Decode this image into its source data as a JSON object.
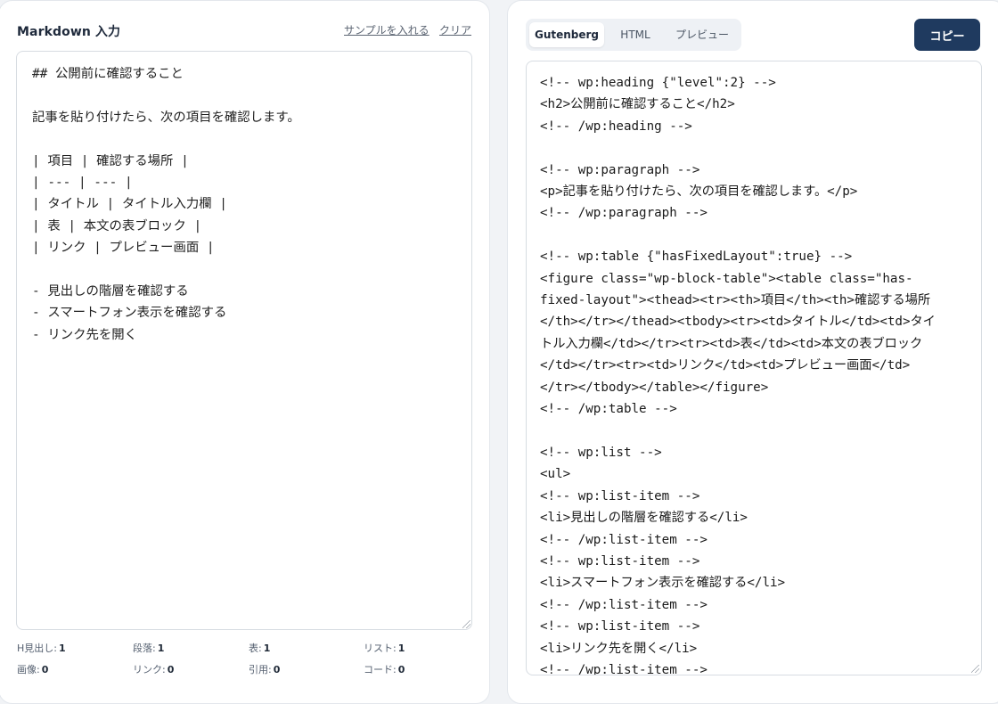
{
  "markdown_panel": {
    "title": "Markdown 入力",
    "sample_link": "サンプルを入れる",
    "clear_link": "クリア",
    "editor_value": "## 公開前に確認すること\n\n記事を貼り付けたら、次の項目を確認します。\n\n| 項目 | 確認する場所 |\n| --- | --- |\n| タイトル | タイトル入力欄 |\n| 表 | 本文の表ブロック |\n| リンク | プレビュー画面 |\n\n- 見出しの階層を確認する\n- スマートフォン表示を確認する\n- リンク先を開く",
    "stats": [
      {
        "label": "H見出し:",
        "value": "1"
      },
      {
        "label": "段落:",
        "value": "1"
      },
      {
        "label": "表:",
        "value": "1"
      },
      {
        "label": "リスト:",
        "value": "1"
      },
      {
        "label": "画像:",
        "value": "0"
      },
      {
        "label": "リンク:",
        "value": "0"
      },
      {
        "label": "引用:",
        "value": "0"
      },
      {
        "label": "コード:",
        "value": "0"
      }
    ]
  },
  "output_panel": {
    "tabs": [
      "Gutenberg",
      "HTML",
      "プレビュー"
    ],
    "active_tab": "Gutenberg",
    "copy_label": "コピー",
    "code": "<!-- wp:heading {\"level\":2} -->\n<h2>公開前に確認すること</h2>\n<!-- /wp:heading -->\n\n<!-- wp:paragraph -->\n<p>記事を貼り付けたら、次の項目を確認します。</p>\n<!-- /wp:paragraph -->\n\n<!-- wp:table {\"hasFixedLayout\":true} -->\n<figure class=\"wp-block-table\"><table class=\"has-\nfixed-layout\"><thead><tr><th>項目</th><th>確認する場所\n</th></tr></thead><tbody><tr><td>タイトル</td><td>タイ\nトル入力欄</td></tr><tr><td>表</td><td>本文の表ブロック\n</td></tr><tr><td>リンク</td><td>プレビュー画面</td>\n</tr></tbody></table></figure>\n<!-- /wp:table -->\n\n<!-- wp:list -->\n<ul>\n<!-- wp:list-item -->\n<li>見出しの階層を確認する</li>\n<!-- /wp:list-item -->\n<!-- wp:list-item -->\n<li>スマートフォン表示を確認する</li>\n<!-- /wp:list-item -->\n<!-- wp:list-item -->\n<li>リンク先を開く</li>\n<!-- /wp:list-item -->"
  }
}
